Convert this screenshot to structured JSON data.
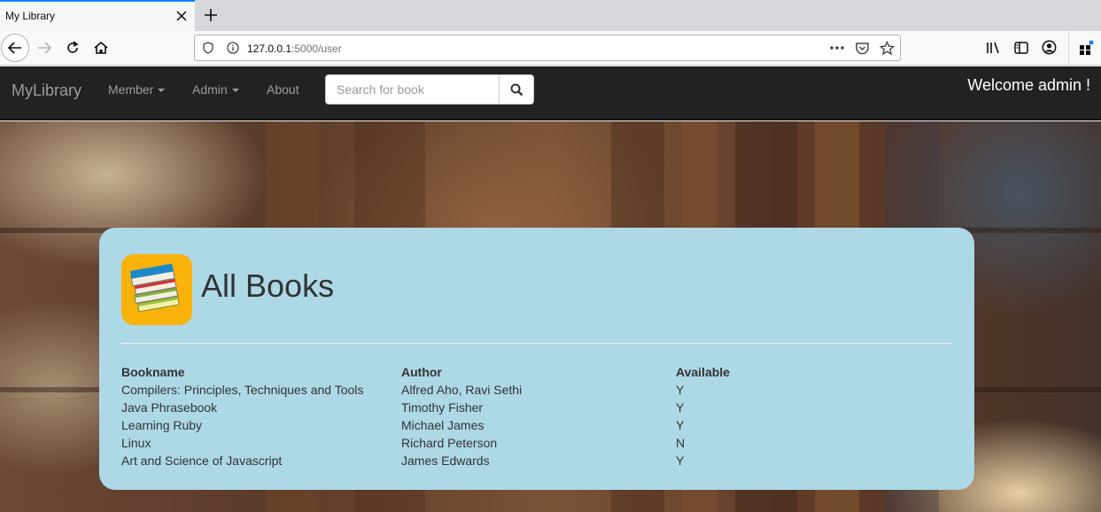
{
  "browser": {
    "tab_title": "My Library",
    "url_host": "127.0.0.1",
    "url_path": ":5000/user"
  },
  "navbar": {
    "brand": "MyLibrary",
    "menu": [
      "Member",
      "Admin",
      "About"
    ],
    "search_placeholder": "Search for book",
    "welcome": "Welcome admin !"
  },
  "main": {
    "title": "All Books",
    "columns": [
      "Bookname",
      "Author",
      "Available"
    ],
    "rows": [
      [
        "Compilers: Principles, Techniques and Tools",
        "Alfred Aho, Ravi Sethi",
        "Y"
      ],
      [
        "Java Phrasebook",
        "Timothy Fisher",
        "Y"
      ],
      [
        "Learning Ruby",
        "Michael James",
        "Y"
      ],
      [
        "Linux",
        "Richard Peterson",
        "N"
      ],
      [
        "Art and Science of Javascript",
        "James Edwards",
        "Y"
      ]
    ]
  },
  "colors": {
    "card_bg": "#add8e6",
    "navbar_bg": "#222222",
    "logo_bg": "#f9b209"
  }
}
